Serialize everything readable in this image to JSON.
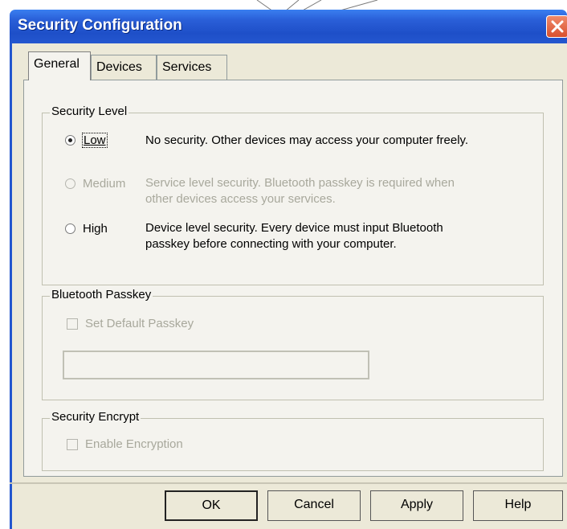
{
  "window": {
    "title": "Security Configuration"
  },
  "tabs": [
    {
      "label": "General",
      "selected": true
    },
    {
      "label": "Devices",
      "selected": false
    },
    {
      "label": "Services",
      "selected": false
    }
  ],
  "security_level": {
    "group_label": "Security Level",
    "options": [
      {
        "label": "Low",
        "description": "No security. Other devices may access your computer freely.",
        "selected": true,
        "enabled": true
      },
      {
        "label": "Medium",
        "description_line1": "Service level security. Bluetooth passkey is required when",
        "description_line2": "other devices access your services.",
        "selected": false,
        "enabled": false
      },
      {
        "label": "High",
        "description_line1": "Device level security. Every device must input Bluetooth",
        "description_line2": "passkey before connecting with your computer.",
        "selected": false,
        "enabled": true
      }
    ]
  },
  "bluetooth_passkey": {
    "group_label": "Bluetooth Passkey",
    "checkbox_label": "Set Default Passkey",
    "checked": false,
    "passkey_value": ""
  },
  "security_encrypt": {
    "group_label": "Security Encrypt",
    "checkbox_label": "Enable Encryption",
    "checked": false
  },
  "buttons": {
    "ok": "OK",
    "cancel": "Cancel",
    "apply": "Apply",
    "help": "Help"
  },
  "colors": {
    "titlebar": "#2457cf",
    "dialog": "#ece9d8",
    "close": "#d8502e",
    "disabled_text": "#a8a89c"
  }
}
